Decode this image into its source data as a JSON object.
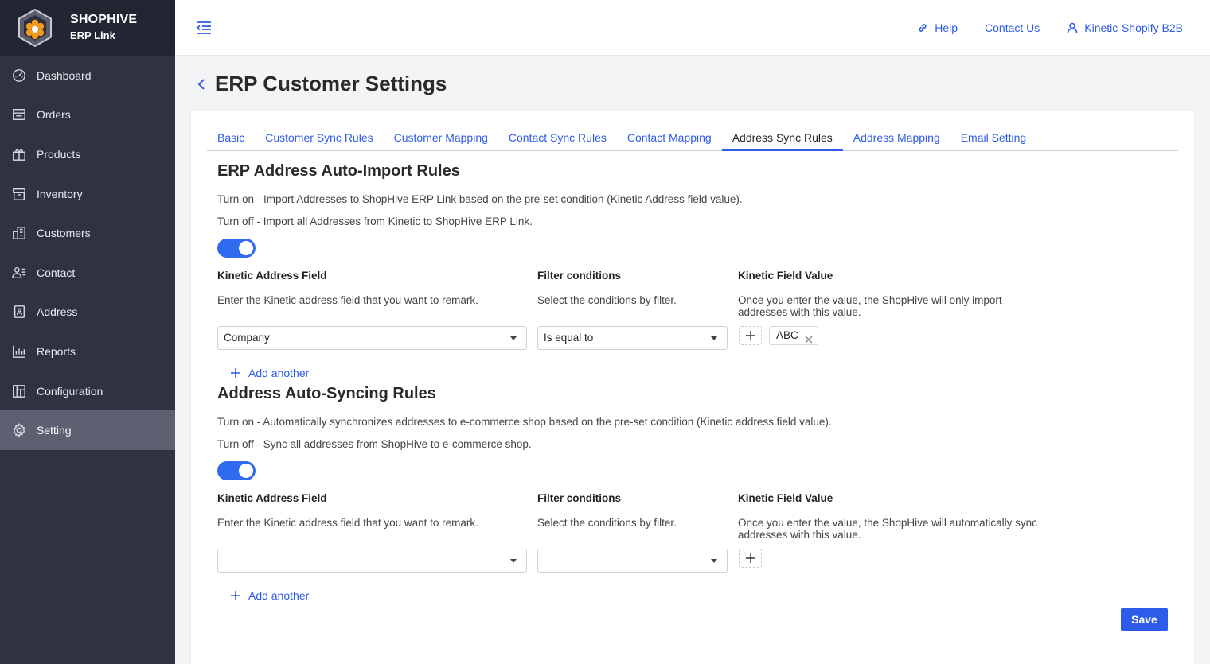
{
  "brand": {
    "name": "SHOPHIVE",
    "subtitle": "ERP Link"
  },
  "sidebar": {
    "items": [
      {
        "label": "Dashboard",
        "icon": "dashboard-icon"
      },
      {
        "label": "Orders",
        "icon": "orders-icon"
      },
      {
        "label": "Products",
        "icon": "products-icon"
      },
      {
        "label": "Inventory",
        "icon": "inventory-icon"
      },
      {
        "label": "Customers",
        "icon": "customers-icon"
      },
      {
        "label": "Contact",
        "icon": "contact-icon"
      },
      {
        "label": "Address",
        "icon": "address-icon"
      },
      {
        "label": "Reports",
        "icon": "reports-icon"
      },
      {
        "label": "Configuration",
        "icon": "configuration-icon"
      },
      {
        "label": "Setting",
        "icon": "gear-icon",
        "active": true
      }
    ]
  },
  "topbar": {
    "help": "Help",
    "contact": "Contact Us",
    "account": "Kinetic-Shopify B2B"
  },
  "page": {
    "title": "ERP Customer Settings"
  },
  "tabs": [
    {
      "label": "Basic"
    },
    {
      "label": "Customer Sync Rules"
    },
    {
      "label": "Customer Mapping"
    },
    {
      "label": "Contact Sync Rules"
    },
    {
      "label": "Contact Mapping"
    },
    {
      "label": "Address Sync Rules",
      "active": true
    },
    {
      "label": "Address Mapping"
    },
    {
      "label": "Email Setting"
    }
  ],
  "import_rules": {
    "title": "ERP Address Auto-Import Rules",
    "turn_on": "Turn on - Import Addresses to ShopHive ERP Link based on the pre-set condition (Kinetic Address field value).",
    "turn_off": "Turn off - Import all Addresses from Kinetic to ShopHive ERP Link.",
    "enabled": true,
    "field_label": "Kinetic Address Field",
    "field_desc": "Enter the Kinetic address field that you want to remark.",
    "filter_label": "Filter conditions",
    "filter_desc": "Select the conditions by filter.",
    "value_label": "Kinetic Field Value",
    "value_desc_1": "Once you enter the value, the ShopHive will only import",
    "value_desc_2": "addresses with this value.",
    "field_value": "Company",
    "filter_value": "Is equal to",
    "tags": [
      "ABC"
    ],
    "add_another": "Add another"
  },
  "sync_rules": {
    "title": "Address Auto-Syncing Rules",
    "turn_on": "Turn on - Automatically synchronizes addresses to e-commerce shop based on the pre-set condition (Kinetic address field value).",
    "turn_off": "Turn off - Sync all addresses from ShopHive to e-commerce shop.",
    "enabled": true,
    "field_label": "Kinetic Address Field",
    "field_desc": "Enter the Kinetic address field that you want to remark.",
    "filter_label": "Filter conditions",
    "filter_desc": "Select the conditions by filter.",
    "value_label": "Kinetic Field Value",
    "value_desc_1": "Once you enter the value, the ShopHive will automatically sync",
    "value_desc_2": "addresses with this value.",
    "field_value": "",
    "filter_value": "",
    "add_another": "Add another"
  },
  "actions": {
    "save": "Save"
  },
  "colors": {
    "sidebar": "#2f3241",
    "accent": "#2f5bea",
    "toggle": "#2f6bef"
  }
}
